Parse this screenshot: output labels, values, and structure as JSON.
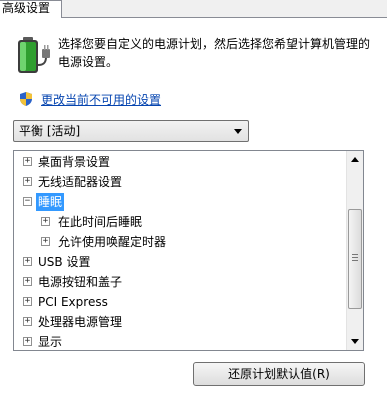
{
  "tab": {
    "label": "高级设置"
  },
  "description": "选择您要自定义的电源计划，然后选择您希望计算机管理的电源设置。",
  "change_settings_link": "更改当前不可用的设置",
  "plan_select": {
    "value": "平衡 [活动]"
  },
  "tree": {
    "items": [
      {
        "label": "桌面背景设置",
        "expander": "+"
      },
      {
        "label": "无线适配器设置",
        "expander": "+"
      },
      {
        "label": "睡眠",
        "expander": "−",
        "selected": true
      },
      {
        "label": "在此时间后睡眠",
        "expander": "+"
      },
      {
        "label": "允许使用唤醒定时器",
        "expander": "+"
      },
      {
        "label": "USB 设置",
        "expander": "+"
      },
      {
        "label": "电源按钮和盖子",
        "expander": "+"
      },
      {
        "label": "PCI Express",
        "expander": "+"
      },
      {
        "label": "处理器电源管理",
        "expander": "+"
      },
      {
        "label": "显示",
        "expander": "+"
      }
    ]
  },
  "restore_button": "还原计划默认值(R)",
  "colors": {
    "selection": "#3399ff",
    "link": "#0645b0"
  },
  "icons": {
    "battery": "battery-plug-icon",
    "shield": "uac-shield-icon"
  }
}
